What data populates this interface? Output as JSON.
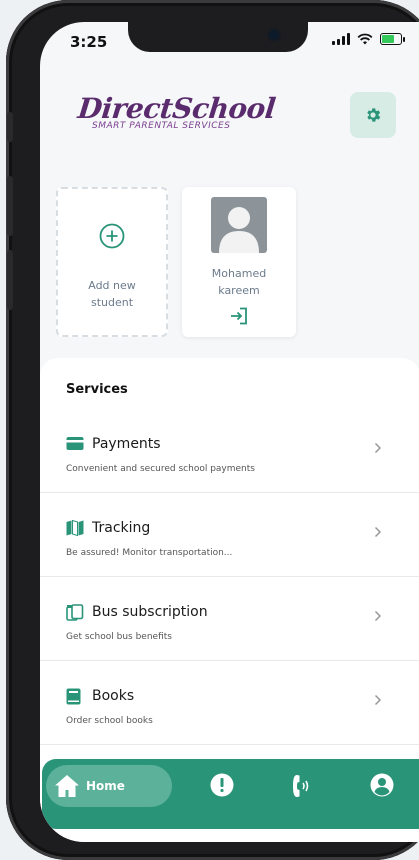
{
  "status_bar": {
    "time": "3:25"
  },
  "brand": {
    "title": "DirectSchool",
    "subtitle": "SMART PARENTAL SERVICES"
  },
  "students": {
    "add_label": "Add new student",
    "add_label_line1": "Add new",
    "add_label_line2": "student",
    "items": [
      {
        "name_line1": "Mohamed",
        "name_line2": "kareem"
      }
    ]
  },
  "services": {
    "title": "Services",
    "items": [
      {
        "name": "Payments",
        "description": "Convenient and secured school payments",
        "icon": "credit-card-icon"
      },
      {
        "name": "Tracking",
        "description": "Be assured! Monitor transportation...",
        "icon": "map-icon"
      },
      {
        "name": "Bus subscription",
        "description": "Get school bus benefits",
        "icon": "bus-card-icon"
      },
      {
        "name": "Books",
        "description": "Order school books",
        "icon": "book-icon"
      }
    ]
  },
  "nav": {
    "home_label": "Home",
    "items": [
      "home-icon",
      "alert-icon",
      "phone-icon",
      "profile-icon"
    ]
  },
  "colors": {
    "accent": "#2a9479",
    "brand": "#5a2c6d",
    "settings_bg": "#d6ece5"
  }
}
